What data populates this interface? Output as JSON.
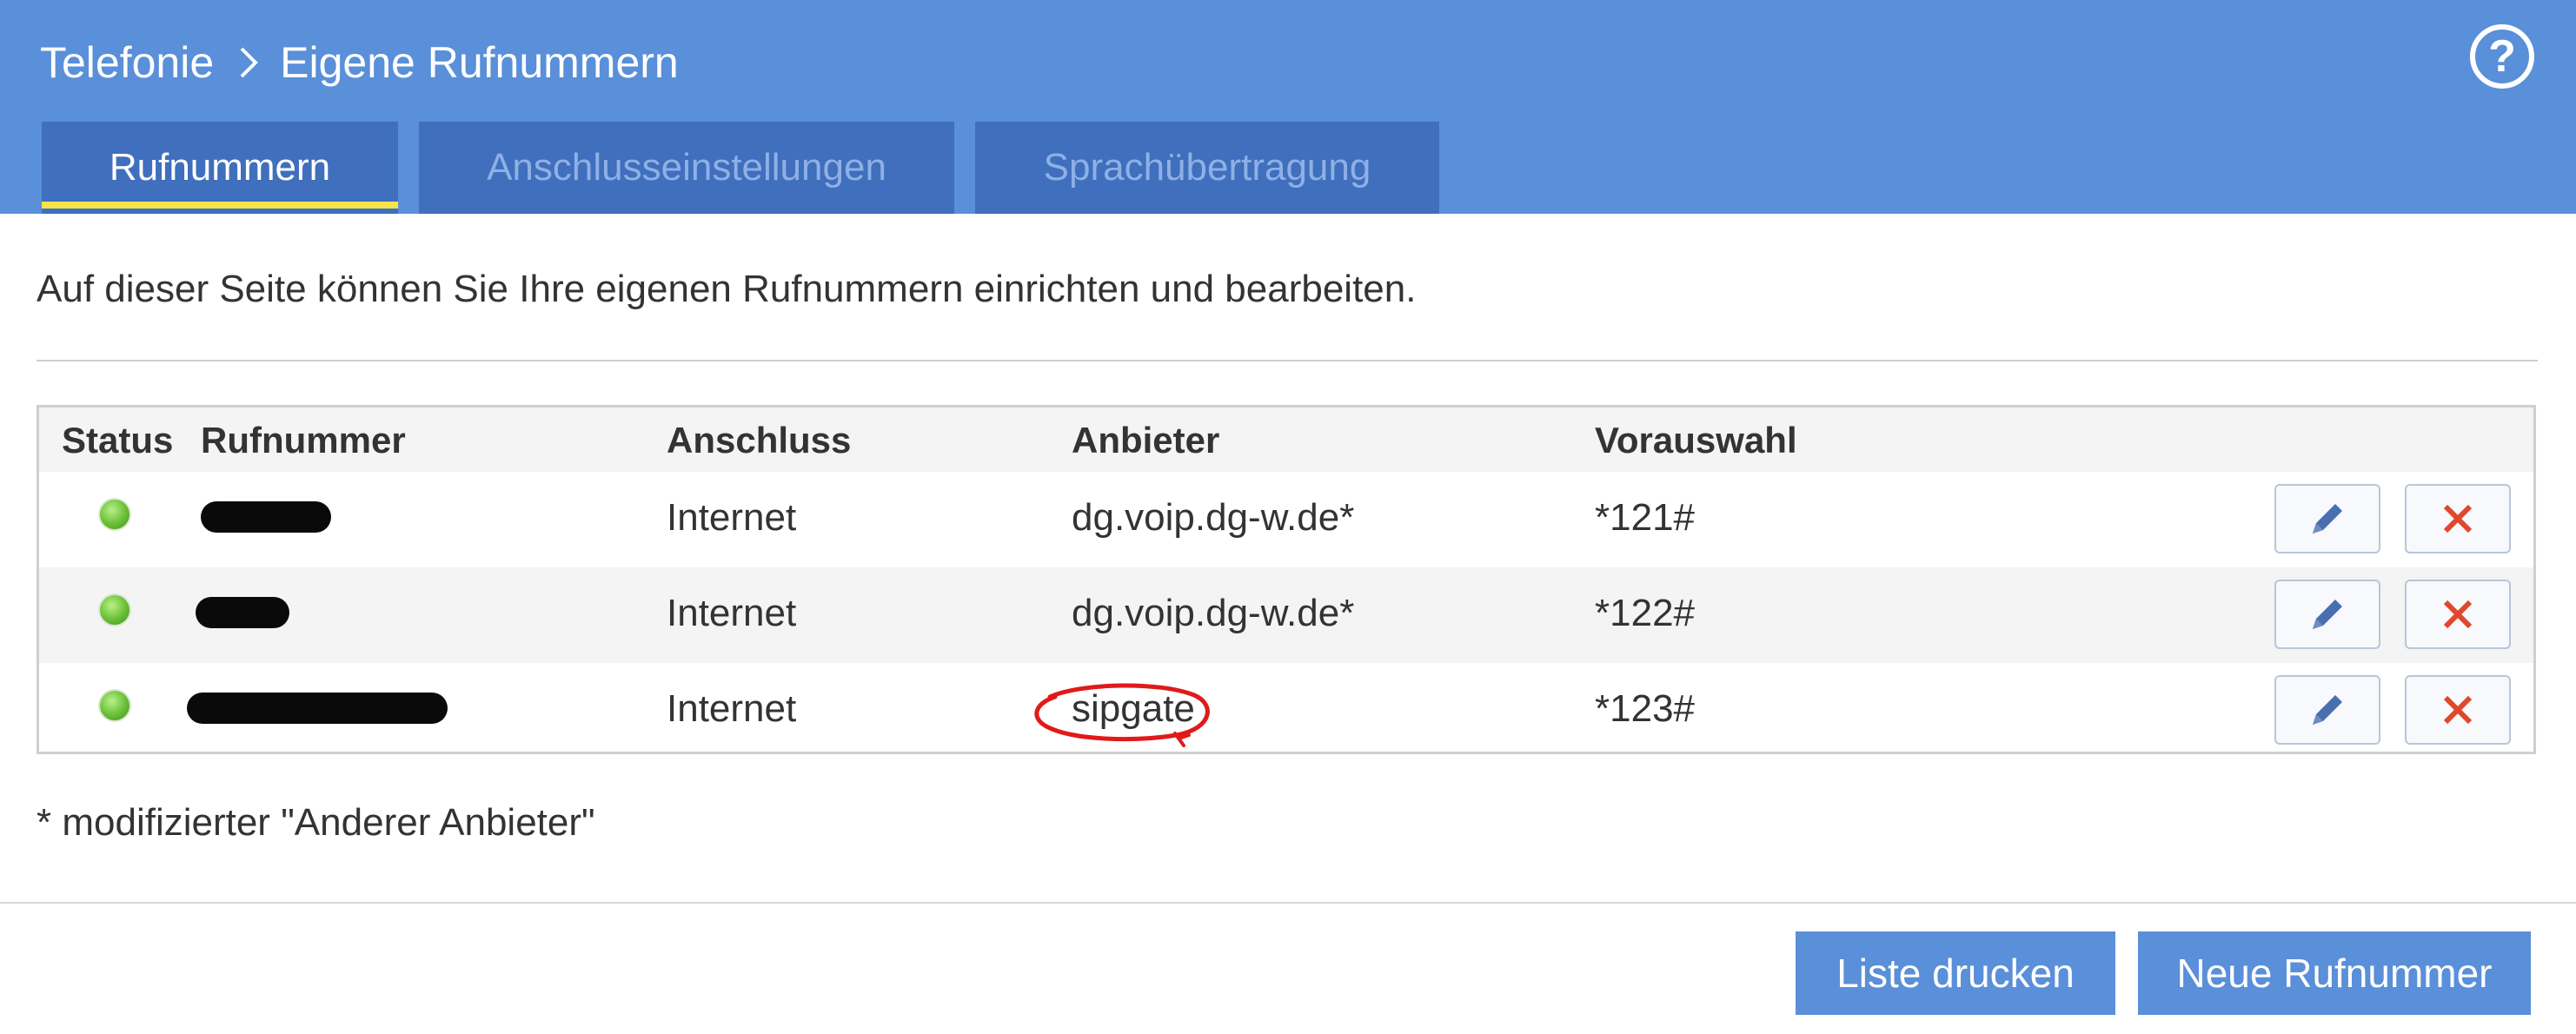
{
  "header": {
    "breadcrumb": [
      "Telefonie",
      "Eigene Rufnummern"
    ],
    "help_glyph": "?",
    "tabs": [
      {
        "label": "Rufnummern",
        "active": true
      },
      {
        "label": "Anschlusseinstellungen",
        "active": false
      },
      {
        "label": "Sprachübertragung",
        "active": false
      }
    ]
  },
  "intro": "Auf dieser Seite können Sie Ihre eigenen Rufnummern einrichten und bearbeiten.",
  "table": {
    "columns": [
      "Status",
      "Rufnummer",
      "Anschluss",
      "Anbieter",
      "Vorauswahl"
    ],
    "rows": [
      {
        "status": "green",
        "rufnummer": "",
        "anschluss": "Internet",
        "anbieter": "dg.voip.dg-w.de*",
        "vorauswahl": "*121#"
      },
      {
        "status": "green",
        "rufnummer": "",
        "anschluss": "Internet",
        "anbieter": "dg.voip.dg-w.de*",
        "vorauswahl": "*122#"
      },
      {
        "status": "green",
        "rufnummer": "",
        "anschluss": "Internet",
        "anbieter": "sipgate",
        "vorauswahl": "*123#"
      }
    ]
  },
  "footnote": "* modifizierter \"Anderer Anbieter\"",
  "footer": {
    "print_label": "Liste drucken",
    "new_label": "Neue Rufnummer"
  },
  "colors": {
    "header_bg": "#5a8fd9",
    "tab_bg": "#3f6fbd",
    "tab_active_underline": "#f7e34a",
    "edit_icon": "#4a6fb0",
    "delete_icon": "#e0482c",
    "annotation_red": "#e01a1a"
  },
  "icons": [
    "chevron-right-icon",
    "help-icon",
    "status-led-icon",
    "pencil-icon",
    "close-icon"
  ]
}
